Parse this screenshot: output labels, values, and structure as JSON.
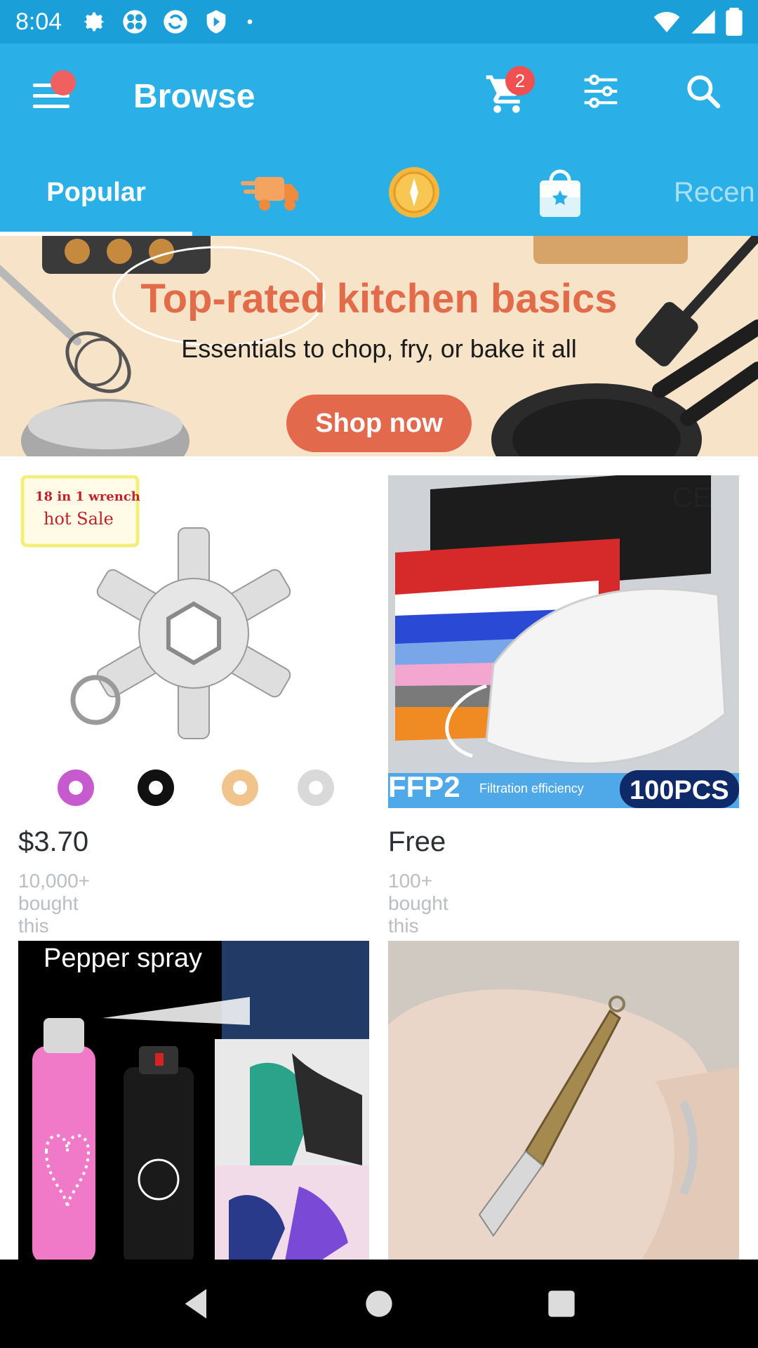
{
  "status_bar": {
    "time": "8:04",
    "icons_left": [
      "gear-icon",
      "fan-icon",
      "sync-icon",
      "play-store-icon",
      "dot-icon"
    ],
    "icons_right": [
      "wifi-icon",
      "signal-icon",
      "battery-icon"
    ]
  },
  "app_bar": {
    "title": "Browse",
    "cart_count": "2"
  },
  "tabs": {
    "popular": "Popular",
    "recent": "Recen",
    "icon_tabs": [
      "delivery-truck-icon",
      "coin-icon",
      "shopping-bag-star-icon"
    ]
  },
  "banner": {
    "title": "Top-rated kitchen basics",
    "subtitle": "Essentials to chop, fry, or bake it all",
    "cta": "Shop now"
  },
  "products": [
    {
      "price": "$3.70",
      "bought": "10,000+ bought this",
      "image_text_1": "18 in 1 wrench",
      "image_text_2": "hot Sale"
    },
    {
      "price": "Free",
      "bought": "100+ bought this",
      "image_text_1": "CE",
      "image_text_2": "FFP2",
      "image_text_3": "Filtration efficiency",
      "image_text_4": "100PCS"
    },
    {
      "image_text_1": "Pepper spray"
    },
    {}
  ],
  "colors": {
    "status_bar": "#1a9fd8",
    "app_bar": "#2ab0e6",
    "badge": "#f05050",
    "banner_bg": "#f6e3c8",
    "banner_accent": "#e2694c"
  }
}
